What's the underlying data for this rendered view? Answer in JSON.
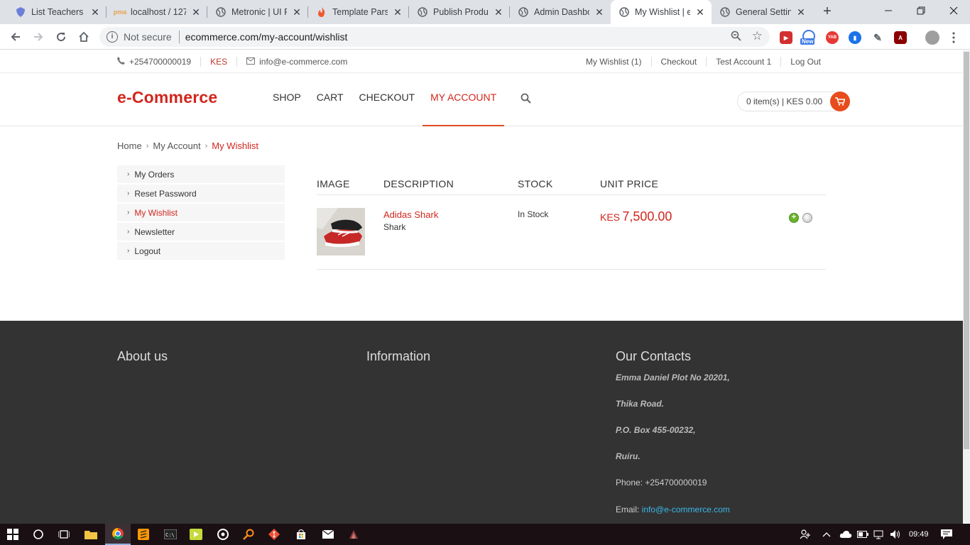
{
  "browser": {
    "tabs": [
      {
        "title": "List Teachers | ",
        "icon": "shield-icon"
      },
      {
        "title": "localhost / 127",
        "icon": "phpmyadmin-icon"
      },
      {
        "title": "Metronic | UI F",
        "icon": "globe-icon"
      },
      {
        "title": "Template Parse",
        "icon": "flame-icon"
      },
      {
        "title": "Publish Produc",
        "icon": "globe-icon"
      },
      {
        "title": "Admin Dashbo",
        "icon": "globe-icon"
      },
      {
        "title": "My Wishlist | e",
        "icon": "globe-icon",
        "active": true
      },
      {
        "title": "General Setting",
        "icon": "globe-icon"
      }
    ],
    "not_secure": "Not secure",
    "url": "ecommerce.com/my-account/wishlist",
    "ext_new_badge": "New",
    "ext_yab": "YAB"
  },
  "topbar": {
    "phone": "+254700000019",
    "currency": "KES",
    "email": "info@e-commerce.com",
    "links": [
      "My Wishlist (1)",
      "Checkout",
      "Test Account 1",
      "Log Out"
    ]
  },
  "header": {
    "logo": "e-Commerce",
    "nav": [
      "SHOP",
      "CART",
      "CHECKOUT",
      "MY ACCOUNT"
    ],
    "active_nav": "MY ACCOUNT",
    "cart_summary": "0 item(s) | KES 0.00"
  },
  "breadcrumb": [
    "Home",
    "My Account",
    "My Wishlist"
  ],
  "account_menu": [
    "My Orders",
    "Reset Password",
    "My Wishlist",
    "Newsletter",
    "Logout"
  ],
  "wishlist": {
    "columns": {
      "image": "IMAGE",
      "description": "DESCRIPTION",
      "stock": "STOCK",
      "price": "UNIT PRICE"
    },
    "items": [
      {
        "name": "Adidas Shark",
        "description": "Shark",
        "stock": "In Stock",
        "currency": "KES",
        "price": "7,500.00"
      }
    ]
  },
  "footer": {
    "about_title": "About us",
    "info_title": "Information",
    "contacts_title": "Our Contacts",
    "address": [
      "Emma Daniel Plot No 20201,",
      "Thika Road.",
      "P.O. Box 455-00232,",
      "Ruiru."
    ],
    "phone_label": "Phone: +254700000019",
    "email_label": "Email:",
    "email": "info@e-commerce.com"
  },
  "taskbar": {
    "time": "09:49"
  },
  "colors": {
    "brand": "#d2261e",
    "cart_button": "#e84c1d",
    "footer_bg": "#333333",
    "link": "#3ab7e8"
  }
}
